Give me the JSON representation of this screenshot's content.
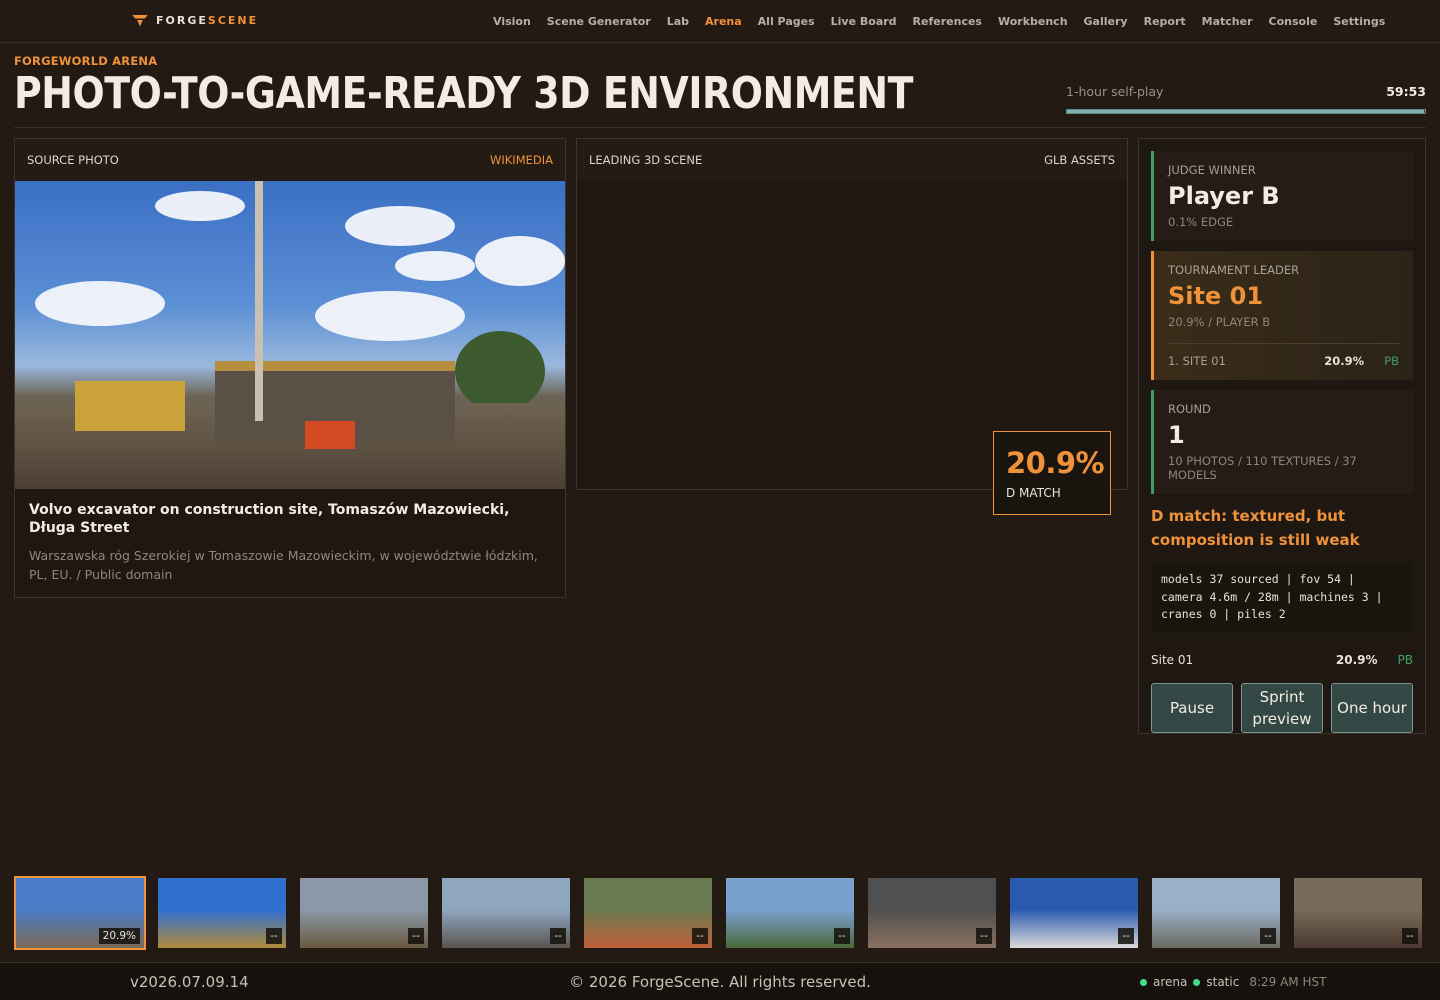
{
  "app": {
    "brand_prefix": "FORGE",
    "brand_suffix": "SCENE",
    "nav": [
      "Vision",
      "Scene Generator",
      "Lab",
      "Arena",
      "All Pages",
      "Live Board",
      "References",
      "Workbench",
      "Gallery",
      "Report",
      "Matcher",
      "Console",
      "Settings"
    ],
    "active_nav": "Arena",
    "accent_color": "#f0923a"
  },
  "header": {
    "eyebrow": "FORGEWORLD ARENA",
    "title": "PHOTO-TO-GAME-READY 3D ENVIRONMENT",
    "timer_label": "1-hour self-play",
    "timer_value": "59:53",
    "timer_progress": 0.998
  },
  "source": {
    "label": "SOURCE PHOTO",
    "provider": "WIKIMEDIA",
    "title": "Volvo excavator on construction site, Tomaszów Mazowiecki, Długa Street",
    "meta": "Warszawska róg Szerokiej w Tomaszowie Mazowieckim, w województwie łódzkim, PL, EU. / Public domain"
  },
  "scene": {
    "label": "LEADING 3D SCENE",
    "assets": "GLB ASSETS",
    "match_value": "20.9%",
    "match_label": "D MATCH"
  },
  "judge": {
    "label": "JUDGE WINNER",
    "value": "Player B",
    "sub": "0.1% EDGE"
  },
  "leader": {
    "label": "TOURNAMENT LEADER",
    "value": "Site 01",
    "sub": "20.9% / PLAYER B",
    "row_name": "1. SITE 01",
    "row_pct": "20.9%",
    "row_tag": "PB"
  },
  "round": {
    "label": "ROUND",
    "value": "1",
    "sub": "10 PHOTOS / 110 TEXTURES / 37 MODELS"
  },
  "verdict": "D match: textured, but composition is still weak",
  "stats": "models 37 sourced | fov 54 | camera 4.6m / 28m | machines 3 | cranes 0 | piles 2",
  "standing": {
    "name": "Site 01",
    "pct": "20.9%",
    "tag": "PB"
  },
  "controls": [
    "Pause",
    "Sprint preview",
    "One hour"
  ],
  "thumbnails": [
    {
      "badge": "20.9%",
      "active": true,
      "colors": [
        "#4a7cc8",
        "#7a6a55"
      ]
    },
    {
      "badge": "--",
      "active": false,
      "colors": [
        "#2f6fd0",
        "#b08a3a"
      ]
    },
    {
      "badge": "--",
      "active": false,
      "colors": [
        "#8a98a8",
        "#6a5a40"
      ]
    },
    {
      "badge": "--",
      "active": false,
      "colors": [
        "#8fa6c0",
        "#5a5550"
      ]
    },
    {
      "badge": "--",
      "active": false,
      "colors": [
        "#6a7a50",
        "#c0603a"
      ]
    },
    {
      "badge": "--",
      "active": false,
      "colors": [
        "#7aa0d0",
        "#4a6a3a"
      ]
    },
    {
      "badge": "--",
      "active": false,
      "colors": [
        "#505050",
        "#8a7060"
      ]
    },
    {
      "badge": "--",
      "active": false,
      "colors": [
        "#2a5ab0",
        "#dadada"
      ]
    },
    {
      "badge": "--",
      "active": false,
      "colors": [
        "#9ab0c8",
        "#6a6a60"
      ]
    },
    {
      "badge": "--",
      "active": false,
      "colors": [
        "#7a6a5a",
        "#4a3a30"
      ]
    }
  ],
  "footer": {
    "version": "v2026.07.09.14",
    "copyright": "© 2026 ForgeScene. All rights reserved.",
    "status_1": "arena",
    "status_2": "static",
    "clock": "8:29 AM HST",
    "status_color": "#3ee08a"
  }
}
